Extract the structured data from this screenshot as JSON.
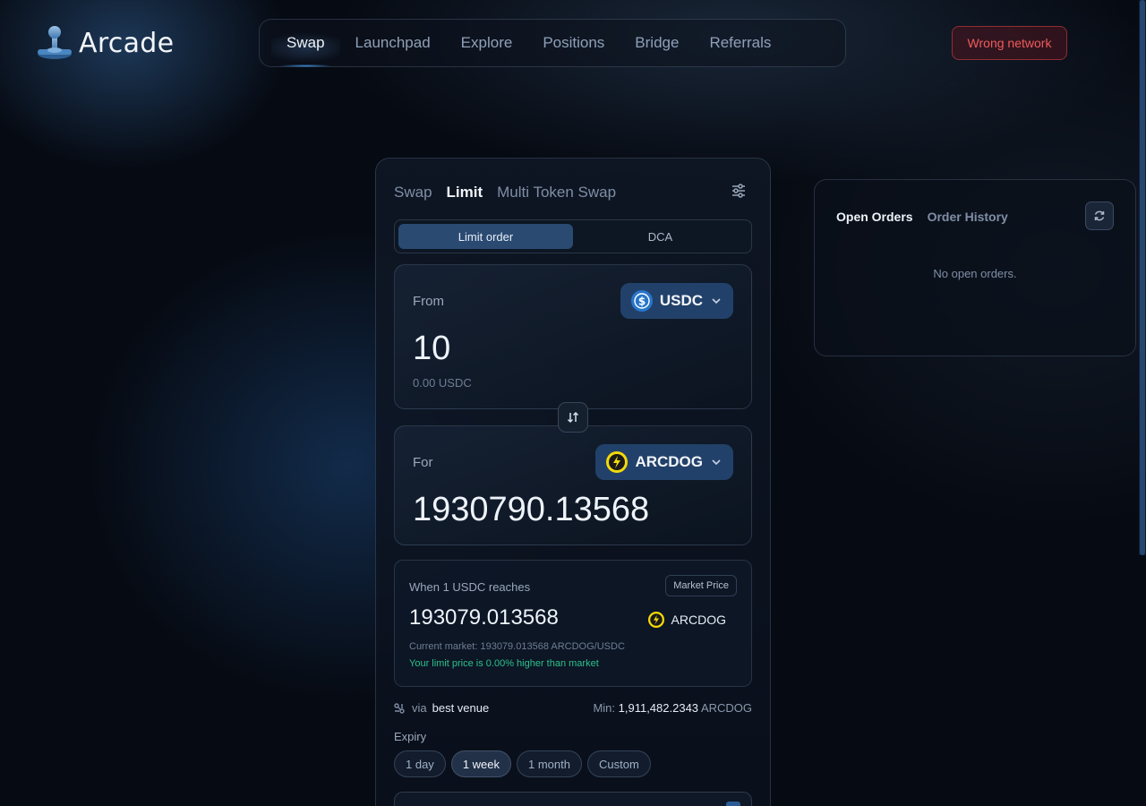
{
  "app": {
    "name": "Arcade"
  },
  "nav": {
    "items": [
      {
        "label": "Swap",
        "active": true
      },
      {
        "label": "Launchpad",
        "active": false
      },
      {
        "label": "Explore",
        "active": false
      },
      {
        "label": "Positions",
        "active": false
      },
      {
        "label": "Bridge",
        "active": false
      },
      {
        "label": "Referrals",
        "active": false
      }
    ]
  },
  "network_button": {
    "label": "Wrong network",
    "color": "#ef5b5b"
  },
  "swap_card": {
    "tabs": [
      {
        "label": "Swap",
        "active": false
      },
      {
        "label": "Limit",
        "active": true
      },
      {
        "label": "Multi Token Swap",
        "active": false
      }
    ],
    "settings_icon": "sliders-icon",
    "mode": {
      "options": [
        "Limit order",
        "DCA"
      ],
      "selected": "Limit order"
    },
    "from": {
      "label": "From",
      "token": "USDC",
      "amount": "10",
      "balance": "0.00 USDC"
    },
    "for": {
      "label": "For",
      "token": "ARCDOG",
      "amount": "1930790.13568"
    },
    "limit": {
      "label": "When 1 USDC reaches",
      "market_button": "Market Price",
      "price": "193079.013568",
      "token": "ARCDOG",
      "current_market": "Current market: 193079.013568 ARCDOG/USDC",
      "diff_text": "Your limit price is 0.00% higher than market",
      "diff_color": "#2dc08a"
    },
    "route": {
      "via": "via",
      "venue": "best venue",
      "min_label": "Min:",
      "min_value": "1,911,482.2343",
      "min_token": "ARCDOG"
    },
    "expiry": {
      "label": "Expiry",
      "options": [
        "1 day",
        "1 week",
        "1 month",
        "Custom"
      ],
      "selected": "1 week"
    }
  },
  "orders": {
    "tabs": [
      {
        "label": "Open Orders",
        "active": true
      },
      {
        "label": "Order History",
        "active": false
      }
    ],
    "empty_text": "No open orders."
  },
  "colors": {
    "accent": "#2a4a72",
    "usdc": "#2775ca",
    "arcdog": "#f5d90a"
  }
}
